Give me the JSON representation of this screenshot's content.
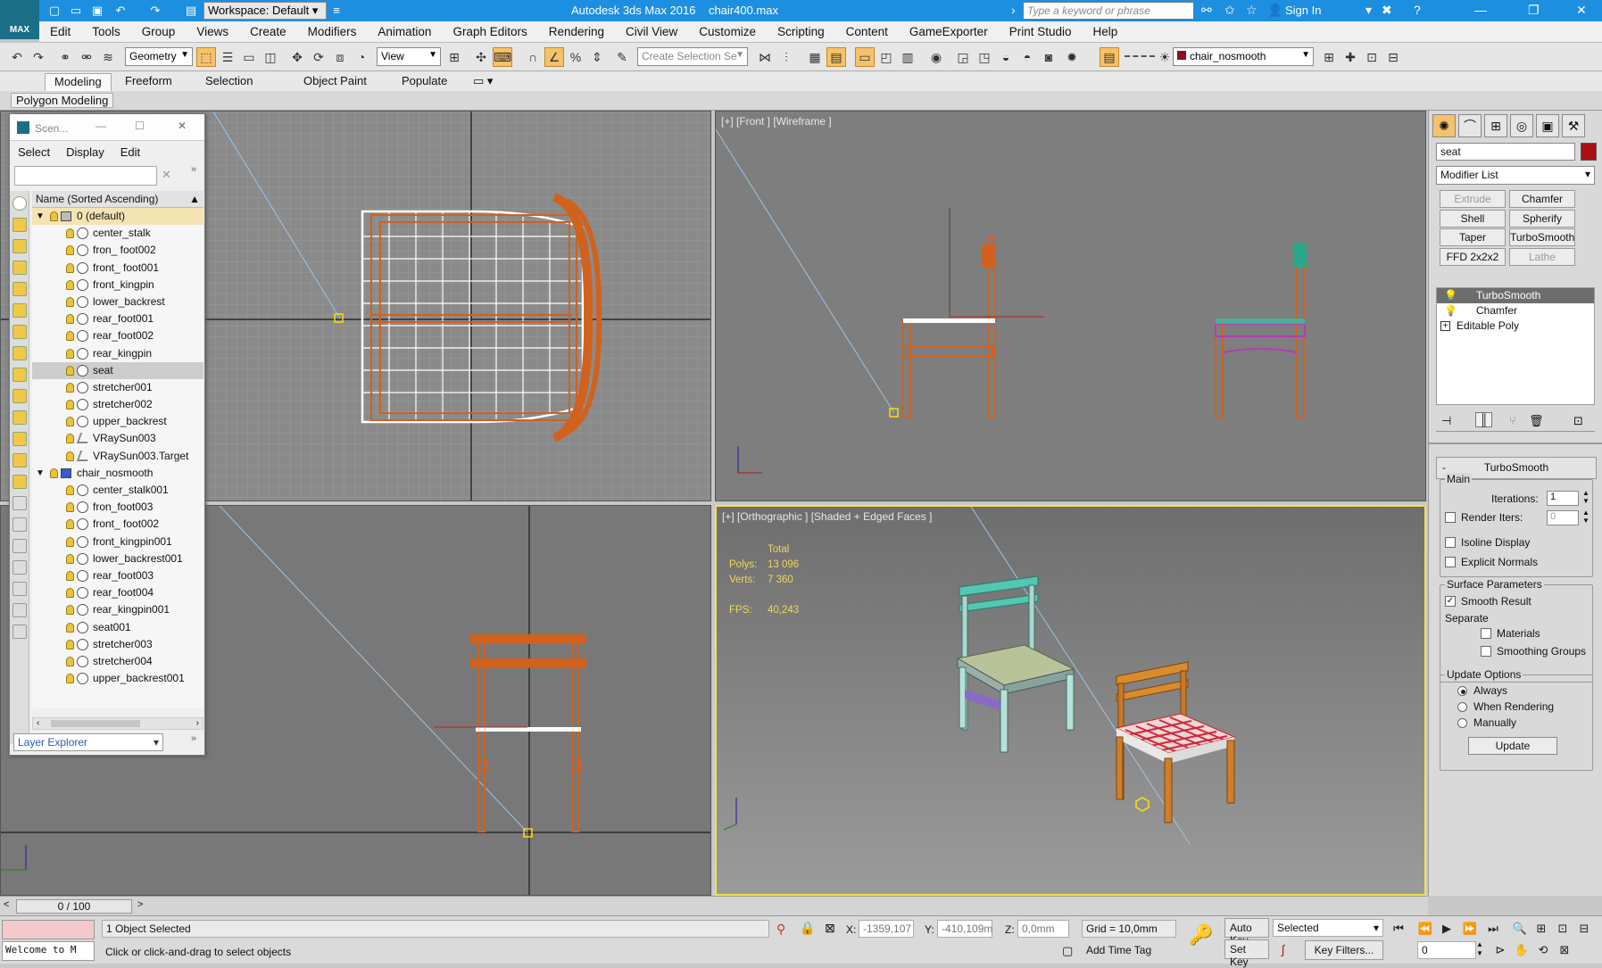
{
  "window": {
    "title": "Autodesk 3ds Max 2016",
    "file": "chair400.max",
    "logo": "MAX",
    "workspace": "Workspace: Default",
    "search_placeholder": "Type a keyword or phrase",
    "sign_in": "Sign In"
  },
  "menu": [
    "Edit",
    "Tools",
    "Group",
    "Views",
    "Create",
    "Modifiers",
    "Animation",
    "Graph Editors",
    "Rendering",
    "Civil View",
    "Customize",
    "Scripting",
    "Content",
    "GameExporter",
    "Print Studio",
    "Help"
  ],
  "toolbar": {
    "filter": "Geometry",
    "ref_coord": "View",
    "selection_set_placeholder": "Create Selection Se",
    "layer_name": "chair_nosmooth"
  },
  "ribbon": {
    "tabs": [
      "Modeling",
      "Freeform",
      "Selection",
      "Object Paint",
      "Populate"
    ],
    "panel": "Polygon Modeling"
  },
  "scene_explorer": {
    "title": "Scen...",
    "menus": [
      "Select",
      "Display",
      "Edit"
    ],
    "column": "Name (Sorted Ascending)",
    "footer": "Layer Explorer",
    "rows": [
      {
        "name": "0 (default)",
        "level": 0,
        "type": "layer",
        "state": "layer"
      },
      {
        "name": "center_stalk",
        "level": 1,
        "type": "object"
      },
      {
        "name": "fron_ foot002",
        "level": 1,
        "type": "object"
      },
      {
        "name": "front_ foot001",
        "level": 1,
        "type": "object"
      },
      {
        "name": "front_kingpin",
        "level": 1,
        "type": "object"
      },
      {
        "name": "lower_backrest",
        "level": 1,
        "type": "object"
      },
      {
        "name": "rear_foot001",
        "level": 1,
        "type": "object"
      },
      {
        "name": "rear_foot002",
        "level": 1,
        "type": "object"
      },
      {
        "name": "rear_kingpin",
        "level": 1,
        "type": "object"
      },
      {
        "name": "seat",
        "level": 1,
        "type": "object",
        "state": "selected"
      },
      {
        "name": "stretcher001",
        "level": 1,
        "type": "object"
      },
      {
        "name": "stretcher002",
        "level": 1,
        "type": "object"
      },
      {
        "name": "upper_backrest",
        "level": 1,
        "type": "object"
      },
      {
        "name": "VRaySun003",
        "level": 1,
        "type": "light"
      },
      {
        "name": "VRaySun003.Target",
        "level": 1,
        "type": "light"
      },
      {
        "name": "chair_nosmooth",
        "level": 0,
        "type": "layer"
      },
      {
        "name": "center_stalk001",
        "level": 1,
        "type": "object"
      },
      {
        "name": "fron_foot003",
        "level": 1,
        "type": "object"
      },
      {
        "name": "front_ foot002",
        "level": 1,
        "type": "object"
      },
      {
        "name": "front_kingpin001",
        "level": 1,
        "type": "object"
      },
      {
        "name": "lower_backrest001",
        "level": 1,
        "type": "object"
      },
      {
        "name": "rear_foot003",
        "level": 1,
        "type": "object"
      },
      {
        "name": "rear_foot004",
        "level": 1,
        "type": "object"
      },
      {
        "name": "rear_kingpin001",
        "level": 1,
        "type": "object"
      },
      {
        "name": "seat001",
        "level": 1,
        "type": "object"
      },
      {
        "name": "stretcher003",
        "level": 1,
        "type": "object"
      },
      {
        "name": "stretcher004",
        "level": 1,
        "type": "object"
      },
      {
        "name": "upper_backrest001",
        "level": 1,
        "type": "object"
      }
    ]
  },
  "viewports": {
    "front_label": "[+] [Front ] [Wireframe ]",
    "persp_label": "[+] [Orthographic ] [Shaded + Edged Faces ]",
    "stats": {
      "total": "Total",
      "polys_label": "Polys:",
      "polys": "13 096",
      "verts_label": "Verts:",
      "verts": "7 360",
      "fps_label": "FPS:",
      "fps": "40,243"
    }
  },
  "command_panel": {
    "object_name": "seat",
    "object_color": "#a81015",
    "modifier_list": "Modifier List",
    "buttons": [
      {
        "label": "Extrude",
        "enabled": false
      },
      {
        "label": "Chamfer",
        "enabled": true
      },
      {
        "label": "Shell",
        "enabled": true
      },
      {
        "label": "Spherify",
        "enabled": true
      },
      {
        "label": "Taper",
        "enabled": true
      },
      {
        "label": "TurboSmooth",
        "enabled": true
      },
      {
        "label": "FFD 2x2x2",
        "enabled": true
      },
      {
        "label": "Lathe",
        "enabled": false
      }
    ],
    "stack": [
      {
        "name": "TurboSmooth",
        "selected": true
      },
      {
        "name": "Chamfer",
        "selected": false
      },
      {
        "name": "Editable Poly",
        "selected": false
      }
    ],
    "turbosmooth": {
      "title": "TurboSmooth",
      "main": "Main",
      "iterations_label": "Iterations:",
      "iterations": "1",
      "render_iters_label": "Render Iters:",
      "render_iters": "0",
      "isoline": "Isoline Display",
      "explicit_normals": "Explicit Normals",
      "surface_params": "Surface Parameters",
      "smooth_result": "Smooth Result",
      "separate": "Separate",
      "materials": "Materials",
      "smoothing_groups": "Smoothing Groups",
      "update_options": "Update Options",
      "always": "Always",
      "when_rendering": "When Rendering",
      "manually": "Manually",
      "update": "Update"
    }
  },
  "status": {
    "frame": "0 / 100",
    "selected": "1 Object Selected",
    "prompt": "Click or click-and-drag to select objects",
    "welcome": "Welcome to M",
    "x_label": "X:",
    "x": "-1359,107",
    "y_label": "Y:",
    "y": "-410,109m",
    "z_label": "Z:",
    "z": "0,0mm",
    "grid": "Grid = 10,0mm",
    "add_time_tag": "Add Time Tag",
    "auto_key": "Auto Key",
    "set_key": "Set Key",
    "key_mode": "Selected",
    "key_filters": "Key Filters...",
    "current_frame": "0"
  }
}
